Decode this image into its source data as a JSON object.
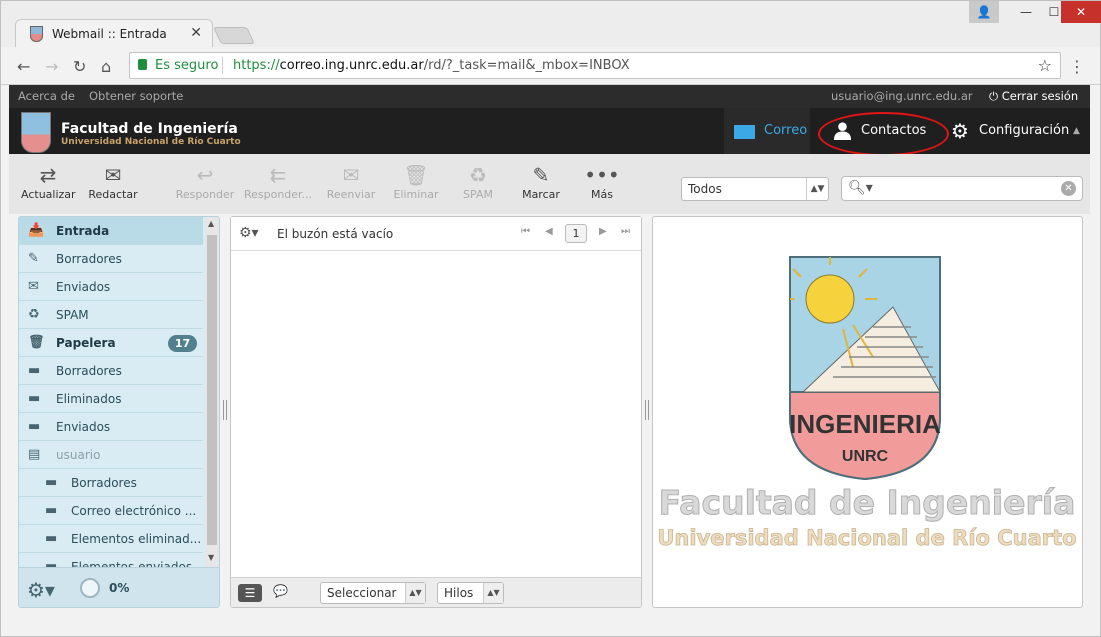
{
  "browser": {
    "tab_title": "Webmail :: Entrada",
    "secure_label": "Es seguro",
    "url_scheme": "https://",
    "url_host": "correo.ing.unrc.edu.ar",
    "url_path": "/rd/?_task=mail&_mbox=INBOX"
  },
  "topline": {
    "about": "Acerca de",
    "support": "Obtener soporte",
    "user": "usuario@ing.unrc.edu.ar",
    "logout": "Cerrar sesión"
  },
  "header": {
    "brand_title": "Facultad de Ingeniería",
    "brand_subtitle": "Universidad Nacional de Río Cuarto",
    "tasks": {
      "mail": "Correo",
      "contacts": "Contactos",
      "settings": "Configuración"
    },
    "highlight_color": "#e01515",
    "accent_color": "#3da8e6"
  },
  "toolbar": {
    "refresh": "Actualizar",
    "compose": "Redactar",
    "reply": "Responder",
    "reply_all": "Responder...",
    "forward": "Reenviar",
    "delete": "Eliminar",
    "spam": "SPAM",
    "mark": "Marcar",
    "more": "Más",
    "filter_value": "Todos"
  },
  "folders": [
    {
      "label": "Entrada",
      "icon": "inbox-icon",
      "bold": true,
      "selected": true
    },
    {
      "label": "Borradores",
      "icon": "pencil-icon"
    },
    {
      "label": "Enviados",
      "icon": "sent-icon"
    },
    {
      "label": "SPAM",
      "icon": "recycle-icon"
    },
    {
      "label": "Papelera",
      "icon": "trash-icon",
      "bold": true,
      "count": "17"
    },
    {
      "label": "Borradores",
      "icon": "folder-icon"
    },
    {
      "label": "Eliminados",
      "icon": "folder-icon"
    },
    {
      "label": "Enviados",
      "icon": "folder-icon"
    },
    {
      "label": "usuario",
      "icon": "folder-stack-icon",
      "dim": true
    },
    {
      "label": "Borradores",
      "icon": "folder-icon",
      "sub": true
    },
    {
      "label": "Correo electrónico ...",
      "icon": "folder-icon",
      "sub": true
    },
    {
      "label": "Elementos eliminad...",
      "icon": "folder-icon",
      "sub": true
    },
    {
      "label": "Elementos enviados",
      "icon": "folder-icon",
      "sub": true
    }
  ],
  "quota": "0%",
  "messagelist": {
    "empty_text": "El buzón está vacío",
    "page": "1",
    "select_label": "Seleccionar",
    "threads_label": "Hilos"
  },
  "preview": {
    "shield_text": "INGENIERIA",
    "shield_sub": "UNRC",
    "line1": "Facultad de Ingeniería",
    "line2": "Universidad Nacional de Río Cuarto"
  }
}
